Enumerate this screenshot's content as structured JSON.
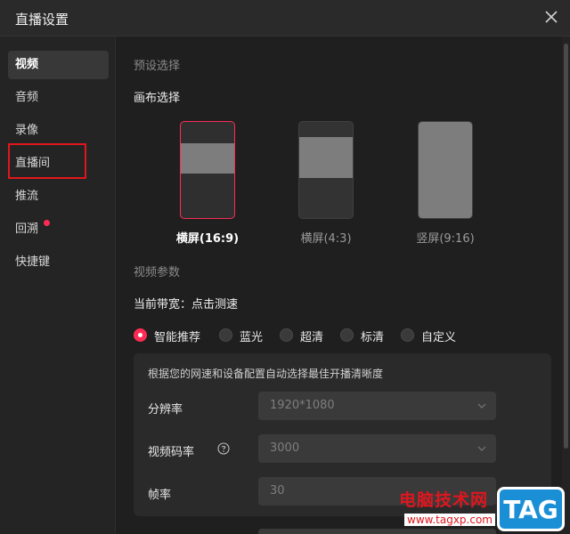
{
  "window": {
    "title": "直播设置",
    "close_icon": "close-icon"
  },
  "sidebar": {
    "items": [
      {
        "label": "视频",
        "active": true
      },
      {
        "label": "音频"
      },
      {
        "label": "录像"
      },
      {
        "label": "直播间",
        "highlighted": true
      },
      {
        "label": "推流"
      },
      {
        "label": "回溯",
        "badge_dot": true
      },
      {
        "label": "快捷键"
      }
    ]
  },
  "main": {
    "preset_title": "预设选择",
    "canvas_title": "画布选择",
    "canvas_options": [
      {
        "label": "横屏(16:9)",
        "selected": true
      },
      {
        "label": "横屏(4:3)"
      },
      {
        "label": "竖屏(9:16)"
      }
    ],
    "video_params_title": "视频参数",
    "bandwidth_label": "当前带宽：点击测速",
    "quality_options": [
      {
        "label": "智能推荐",
        "selected": true
      },
      {
        "label": "蓝光"
      },
      {
        "label": "超清"
      },
      {
        "label": "标清"
      },
      {
        "label": "自定义"
      }
    ],
    "panel": {
      "description": "根据您的网速和设备配置自动选择最佳开播清晰度",
      "fields": [
        {
          "label": "分辨率",
          "value": "1920*1080"
        },
        {
          "label": "视频码率",
          "value": "3000",
          "help_icon": "question-circle-icon"
        },
        {
          "label": "帧率",
          "value": "30"
        }
      ]
    }
  },
  "watermark": {
    "site_name": "电脑技术网",
    "url": "www.tagxp.com",
    "logo_text": "TAG"
  },
  "colors": {
    "accent": "#fe2c55",
    "highlight_box": "#e0161e",
    "background": "#1f1f1f",
    "sidebar_bg": "#242424"
  }
}
